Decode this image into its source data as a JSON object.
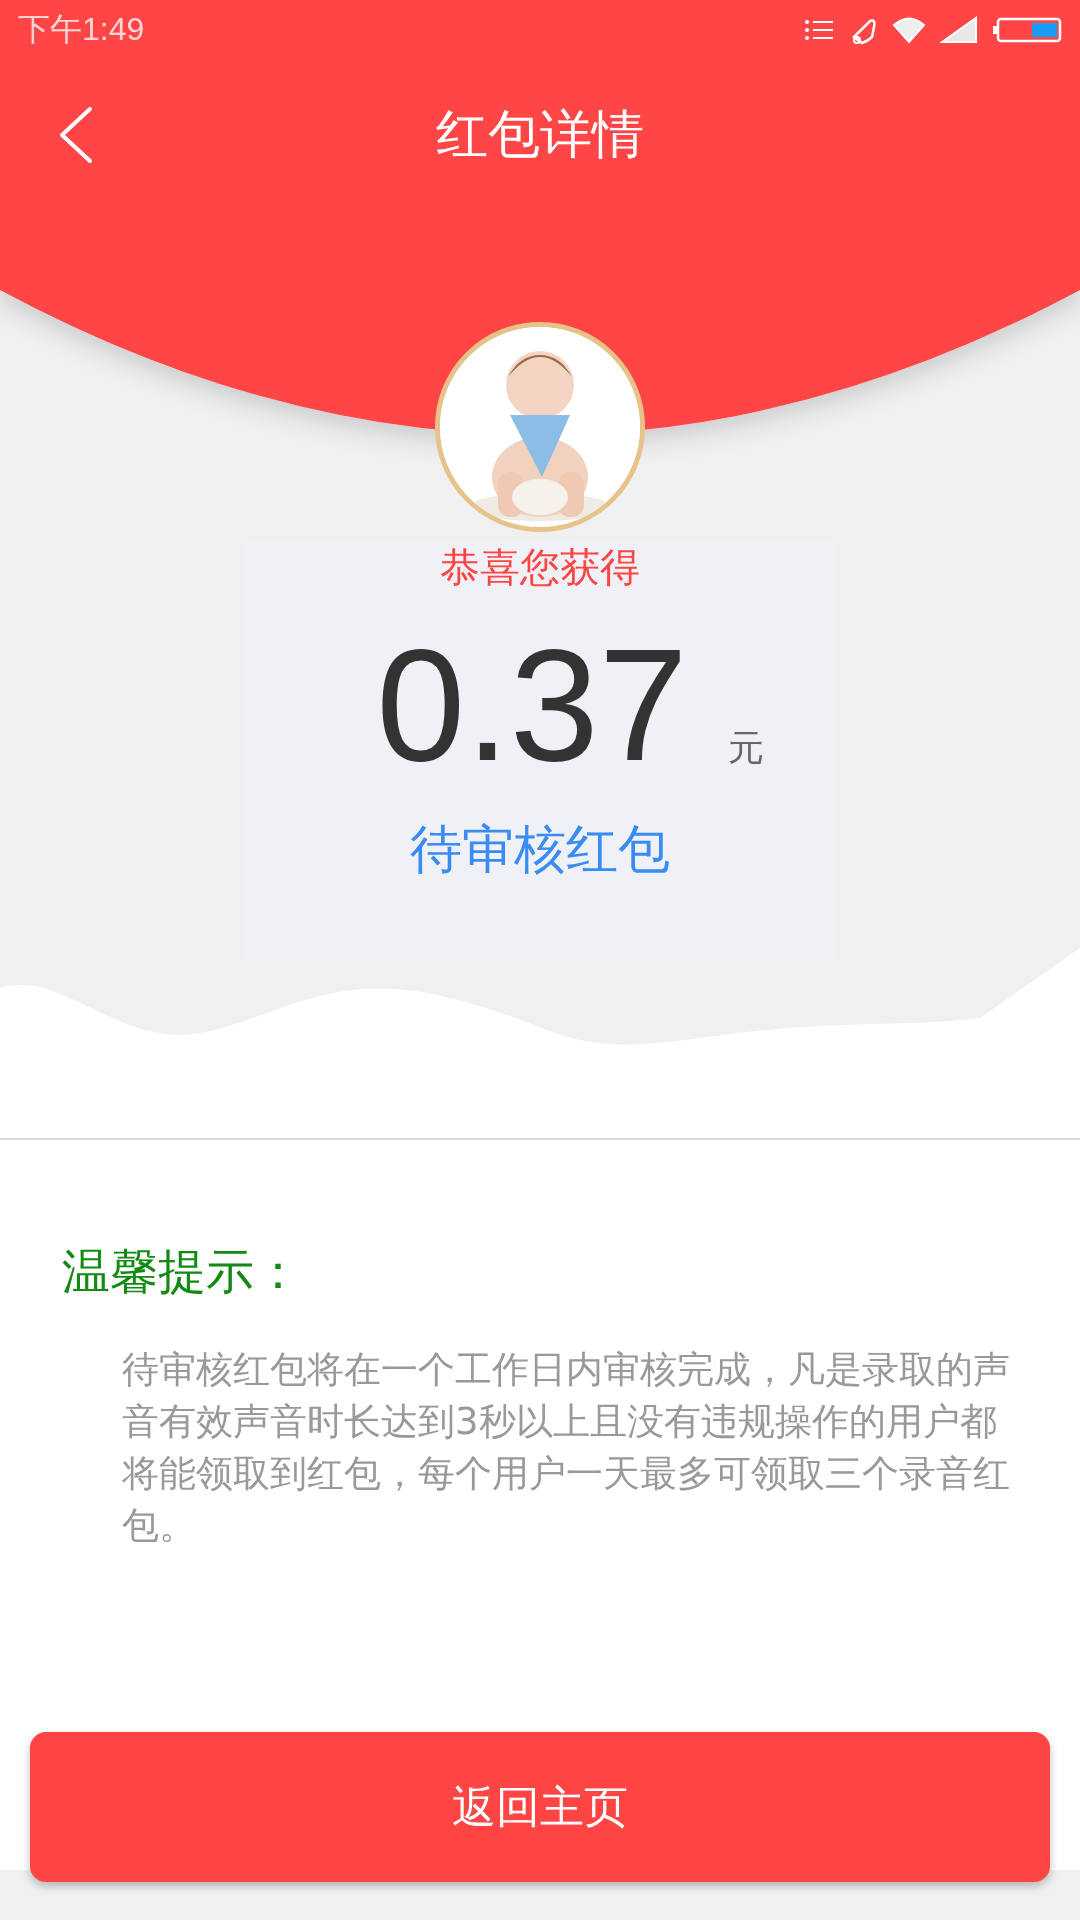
{
  "status_bar": {
    "time": "下午1:49"
  },
  "nav": {
    "title": "红包详情"
  },
  "result": {
    "heading": "恭喜您获得",
    "amount": "0.37",
    "unit": "元",
    "status": "待审核红包"
  },
  "tips": {
    "title": "温馨提示：",
    "body": "待审核红包将在一个工作日内审核完成，凡是录取的声音有效声音时长达到3秒以上且没有违规操作的用户都将能领取到红包，每个用户一天最多可领取三个录音红包。"
  },
  "button": "返回主页"
}
